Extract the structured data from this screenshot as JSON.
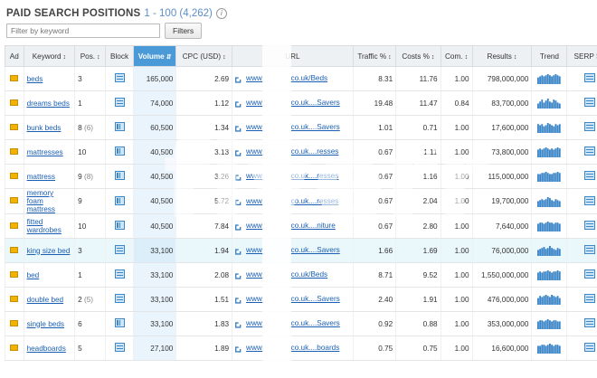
{
  "header": {
    "title": "PAID SEARCH POSITIONS",
    "range": "1 - 100 (4,262)",
    "info_glyph": "i"
  },
  "filter": {
    "placeholder": "Filter by keyword",
    "button_label": "Filters"
  },
  "columns": [
    "Ad",
    "Keyword",
    "Pos.",
    "Block",
    "Volume",
    "CPC (USD)",
    "URL",
    "Traffic %",
    "Costs %",
    "Com.",
    "Results",
    "Trend",
    "SERP So"
  ],
  "sort_column": "Volume",
  "colors": {
    "accent": "#4b9ad8",
    "link": "#1a5fb4",
    "highlight_row": "#eaf7fb"
  },
  "watermark": {
    "text": "fiverr",
    "mark": "R"
  },
  "rows": [
    {
      "keyword": "beds",
      "pos": "3",
      "pos_sub": "",
      "volume": "165,000",
      "cpc": "2.69",
      "url_a": "www.",
      "url_b": "co.uk/Beds",
      "traffic": "8.31",
      "costs": "11.76",
      "com": "1.00",
      "results": "798,000,000",
      "block": 1,
      "trend": [
        6,
        7,
        8,
        7,
        8,
        9,
        8,
        7,
        8,
        9,
        8,
        7
      ]
    },
    {
      "keyword": "dreams beds",
      "pos": "1",
      "pos_sub": "",
      "volume": "74,000",
      "cpc": "1.12",
      "url_a": "www.",
      "url_b": "co.uk....Savers",
      "traffic": "19.48",
      "costs": "11.47",
      "com": "0.84",
      "results": "83,700,000",
      "block": 1,
      "trend": [
        5,
        7,
        9,
        6,
        8,
        10,
        7,
        6,
        9,
        8,
        6,
        5
      ]
    },
    {
      "keyword": "bunk beds",
      "pos": "8",
      "pos_sub": "(6)",
      "volume": "60,500",
      "cpc": "1.34",
      "url_a": "www.",
      "url_b": "co.uk....Savers",
      "traffic": "1.01",
      "costs": "0.71",
      "com": "1.00",
      "results": "17,600,000",
      "block": 2,
      "trend": [
        8,
        7,
        8,
        6,
        7,
        9,
        8,
        7,
        6,
        8,
        7,
        8
      ]
    },
    {
      "keyword": "mattresses",
      "pos": "10",
      "pos_sub": "",
      "volume": "40,500",
      "cpc": "3.13",
      "url_a": "www.",
      "url_b": "co.uk....resses",
      "traffic": "0.67",
      "costs": "1.11",
      "com": "1.00",
      "results": "73,800,000",
      "block": 2,
      "trend": [
        7,
        8,
        7,
        8,
        9,
        8,
        7,
        8,
        7,
        8,
        9,
        8
      ]
    },
    {
      "keyword": "mattress",
      "pos": "9",
      "pos_sub": "(8)",
      "volume": "40,500",
      "cpc": "3.26",
      "url_a": "www.",
      "url_b": "co.uk....resses",
      "traffic": "0.67",
      "costs": "1.16",
      "com": "1.00",
      "results": "115,000,000",
      "block": 2,
      "trend": [
        7,
        7,
        8,
        8,
        9,
        8,
        7,
        7,
        8,
        8,
        9,
        8
      ]
    },
    {
      "keyword": "memory foam mattress",
      "pos": "9",
      "pos_sub": "",
      "volume": "40,500",
      "cpc": "5.72",
      "url_a": "www.",
      "url_b": "co.uk....resses",
      "traffic": "0.67",
      "costs": "2.04",
      "com": "1.00",
      "results": "19,700,000",
      "block": 2,
      "trend": [
        6,
        7,
        8,
        7,
        8,
        10,
        9,
        7,
        6,
        8,
        7,
        6
      ]
    },
    {
      "keyword": "fitted wardrobes",
      "pos": "10",
      "pos_sub": "",
      "volume": "40,500",
      "cpc": "7.84",
      "url_a": "www.",
      "url_b": "co.uk....niture",
      "traffic": "0.67",
      "costs": "2.80",
      "com": "1.00",
      "results": "7,640,000",
      "block": 2,
      "trend": [
        7,
        8,
        8,
        7,
        8,
        9,
        8,
        8,
        7,
        8,
        8,
        7
      ]
    },
    {
      "keyword": "king size bed",
      "pos": "3",
      "pos_sub": "",
      "volume": "33,100",
      "cpc": "1.94",
      "url_a": "www.",
      "url_b": "co.uk....Savers",
      "traffic": "1.66",
      "costs": "1.69",
      "com": "1.00",
      "results": "76,000,000",
      "block": 1,
      "trend": [
        6,
        7,
        8,
        9,
        7,
        8,
        10,
        8,
        7,
        6,
        8,
        7
      ],
      "highlight": true
    },
    {
      "keyword": "bed",
      "pos": "1",
      "pos_sub": "",
      "volume": "33,100",
      "cpc": "2.08",
      "url_a": "www.",
      "url_b": "co.uk/Beds",
      "traffic": "8.71",
      "costs": "9.52",
      "com": "1.00",
      "results": "1,550,000,000",
      "block": 1,
      "trend": [
        7,
        8,
        7,
        8,
        8,
        9,
        8,
        7,
        8,
        8,
        9,
        8
      ]
    },
    {
      "keyword": "double bed",
      "pos": "2",
      "pos_sub": "(5)",
      "volume": "33,100",
      "cpc": "1.51",
      "url_a": "www.",
      "url_b": "co.uk....Savers",
      "traffic": "2.40",
      "costs": "1.91",
      "com": "1.00",
      "results": "476,000,000",
      "block": 1,
      "trend": [
        6,
        8,
        7,
        8,
        9,
        8,
        7,
        9,
        8,
        7,
        8,
        6
      ]
    },
    {
      "keyword": "single beds",
      "pos": "6",
      "pos_sub": "",
      "volume": "33,100",
      "cpc": "1.83",
      "url_a": "www.",
      "url_b": "co.uk....Savers",
      "traffic": "0.92",
      "costs": "0.88",
      "com": "1.00",
      "results": "353,000,000",
      "block": 2,
      "trend": [
        7,
        8,
        8,
        7,
        8,
        9,
        8,
        7,
        8,
        8,
        7,
        7
      ]
    },
    {
      "keyword": "headboards",
      "pos": "5",
      "pos_sub": "",
      "volume": "27,100",
      "cpc": "1.89",
      "url_a": "www.",
      "url_b": "co.uk....boards",
      "traffic": "0.75",
      "costs": "0.75",
      "com": "1.00",
      "results": "16,600,000",
      "block": 1,
      "trend": [
        7,
        7,
        8,
        8,
        7,
        8,
        9,
        8,
        7,
        8,
        8,
        7
      ]
    }
  ]
}
